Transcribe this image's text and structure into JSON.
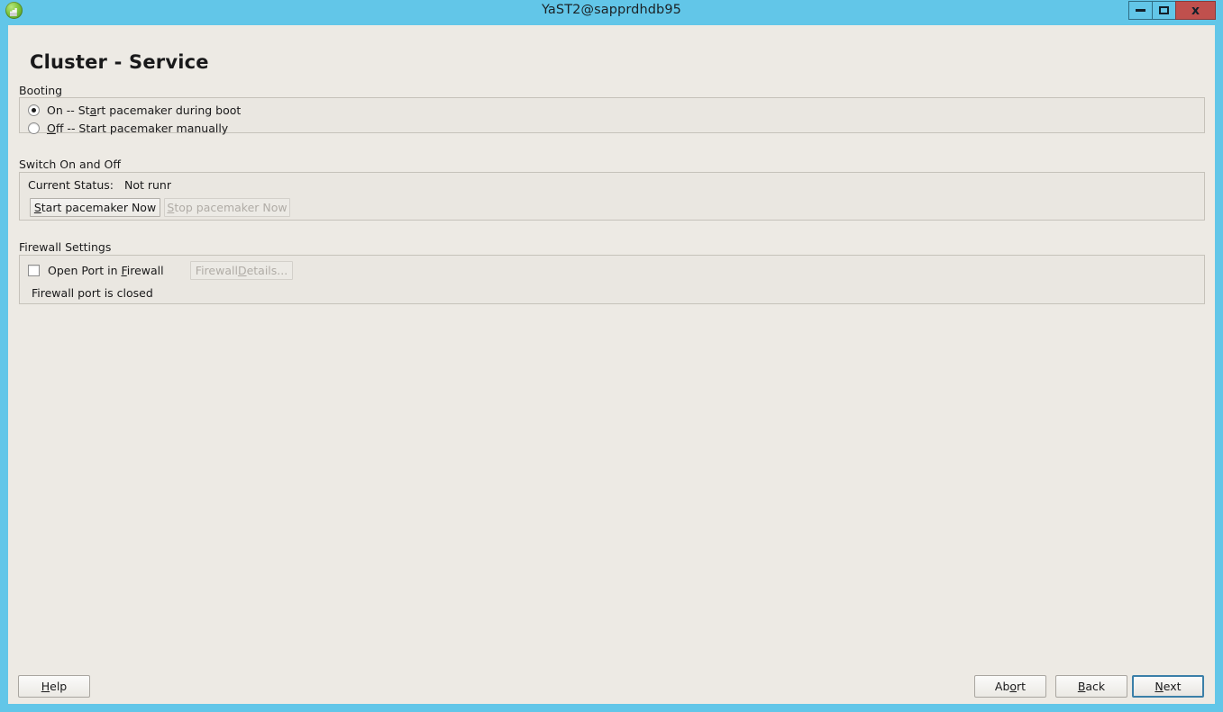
{
  "window": {
    "title": "YaST2@sapprdhdb95",
    "icon": "yast-globe-icon",
    "controls": {
      "minimize": "minimize-icon",
      "maximize": "maximize-icon",
      "close": "x"
    },
    "colors": {
      "titlebar": "#62c6e8",
      "client_background": "#edeae4",
      "close_button": "#c0504d",
      "focus_border": "#3b7fa8"
    }
  },
  "page": {
    "heading": "Cluster - Service"
  },
  "booting": {
    "group_label": "Booting",
    "options": [
      {
        "label_pre": "On -- St",
        "label_accel": "a",
        "label_post": "rt pacemaker during boot",
        "selected": true
      },
      {
        "label_pre": "",
        "label_accel": "O",
        "label_post": "ff -- Start pacemaker manually",
        "selected": false
      }
    ]
  },
  "switch_on_off": {
    "group_label": "Switch On and Off",
    "status_label": "Current Status:",
    "status_value": "Not runr",
    "start_button": {
      "pre": "",
      "accel": "S",
      "post": "tart pacemaker Now",
      "enabled": true
    },
    "stop_button": {
      "pre": "",
      "accel": "S",
      "post": "top pacemaker Now",
      "enabled": false
    }
  },
  "firewall": {
    "group_label": "Firewall Settings",
    "checkbox": {
      "pre": "Open Port in ",
      "accel": "F",
      "post": "irewall",
      "checked": false
    },
    "details_button": {
      "pre": "Firewall ",
      "accel": "D",
      "post": "etails...",
      "enabled": false
    },
    "status_text": "Firewall port is closed"
  },
  "footer": {
    "help": {
      "pre": "",
      "accel": "H",
      "post": "elp"
    },
    "abort": {
      "pre": "Ab",
      "accel": "o",
      "post": "rt"
    },
    "back": {
      "pre": "",
      "accel": "B",
      "post": "ack"
    },
    "next": {
      "pre": "",
      "accel": "N",
      "post": "ext",
      "focused": true
    }
  }
}
